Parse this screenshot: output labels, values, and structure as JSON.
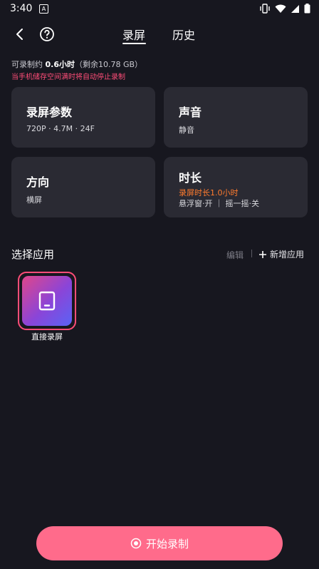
{
  "status_bar": {
    "time": "3:40",
    "badge": "A"
  },
  "header": {
    "tabs": [
      {
        "label": "录屏",
        "active": true
      },
      {
        "label": "历史",
        "active": false
      }
    ]
  },
  "storage": {
    "prefix": "可录制约 ",
    "hours": "0.6小时",
    "remain": "（剩余10.78 GB）",
    "warning": "当手机储存空间满时将自动停止录制"
  },
  "cards": {
    "params": {
      "title": "录屏参数",
      "value": "720P · 4.7M · 24F"
    },
    "sound": {
      "title": "声音",
      "value": "静音"
    },
    "orientation": {
      "title": "方向",
      "value": "横屏"
    },
    "duration": {
      "title": "时长",
      "limit": "录屏时长1.0小时",
      "options": "悬浮窗·开 ｜ 摇一摇·关"
    }
  },
  "apps_section": {
    "title": "选择应用",
    "edit_label": "编辑",
    "add_label": "新增应用",
    "items": [
      {
        "label": "直接录屏"
      }
    ]
  },
  "start_button": {
    "label": "开始录制"
  },
  "colors": {
    "accent": "#ff6b8b",
    "warning": "#ff4d78",
    "orange": "#ff7b2e",
    "card": "#2a2a33",
    "background": "#17171f"
  }
}
